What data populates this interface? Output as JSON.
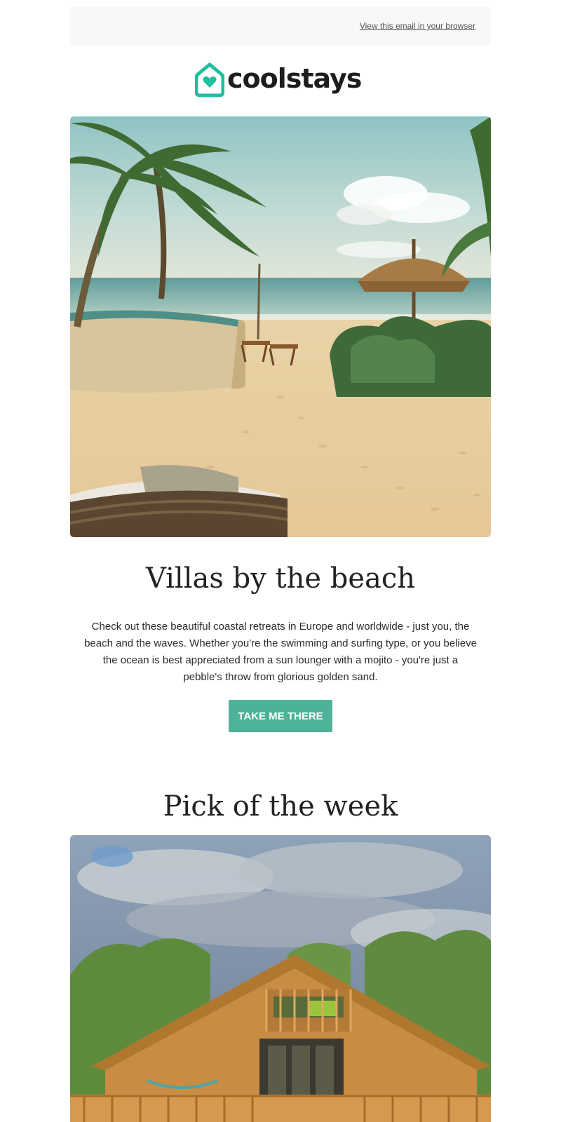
{
  "header": {
    "view_in_browser": "View this email in your browser"
  },
  "brand": {
    "name": "coolstays",
    "accent_color": "#1fbf9f",
    "logo_icon": "house-heart-icon"
  },
  "hero": {
    "image": "beach-villa-photo"
  },
  "feature": {
    "title": "Villas by the beach",
    "description": "Check out these beautiful coastal retreats in Europe and worldwide - just you, the beach and the waves. Whether you're the swimming and surfing type, or you believe the ocean is best appreciated from a sun lounger with a mojito - you're just a pebble's throw from glorious golden sand.",
    "cta_label": "TAKE ME THERE",
    "cta_color": "#4db297"
  },
  "pick": {
    "title": "Pick of the week",
    "image": "wooden-lodge-photo"
  }
}
